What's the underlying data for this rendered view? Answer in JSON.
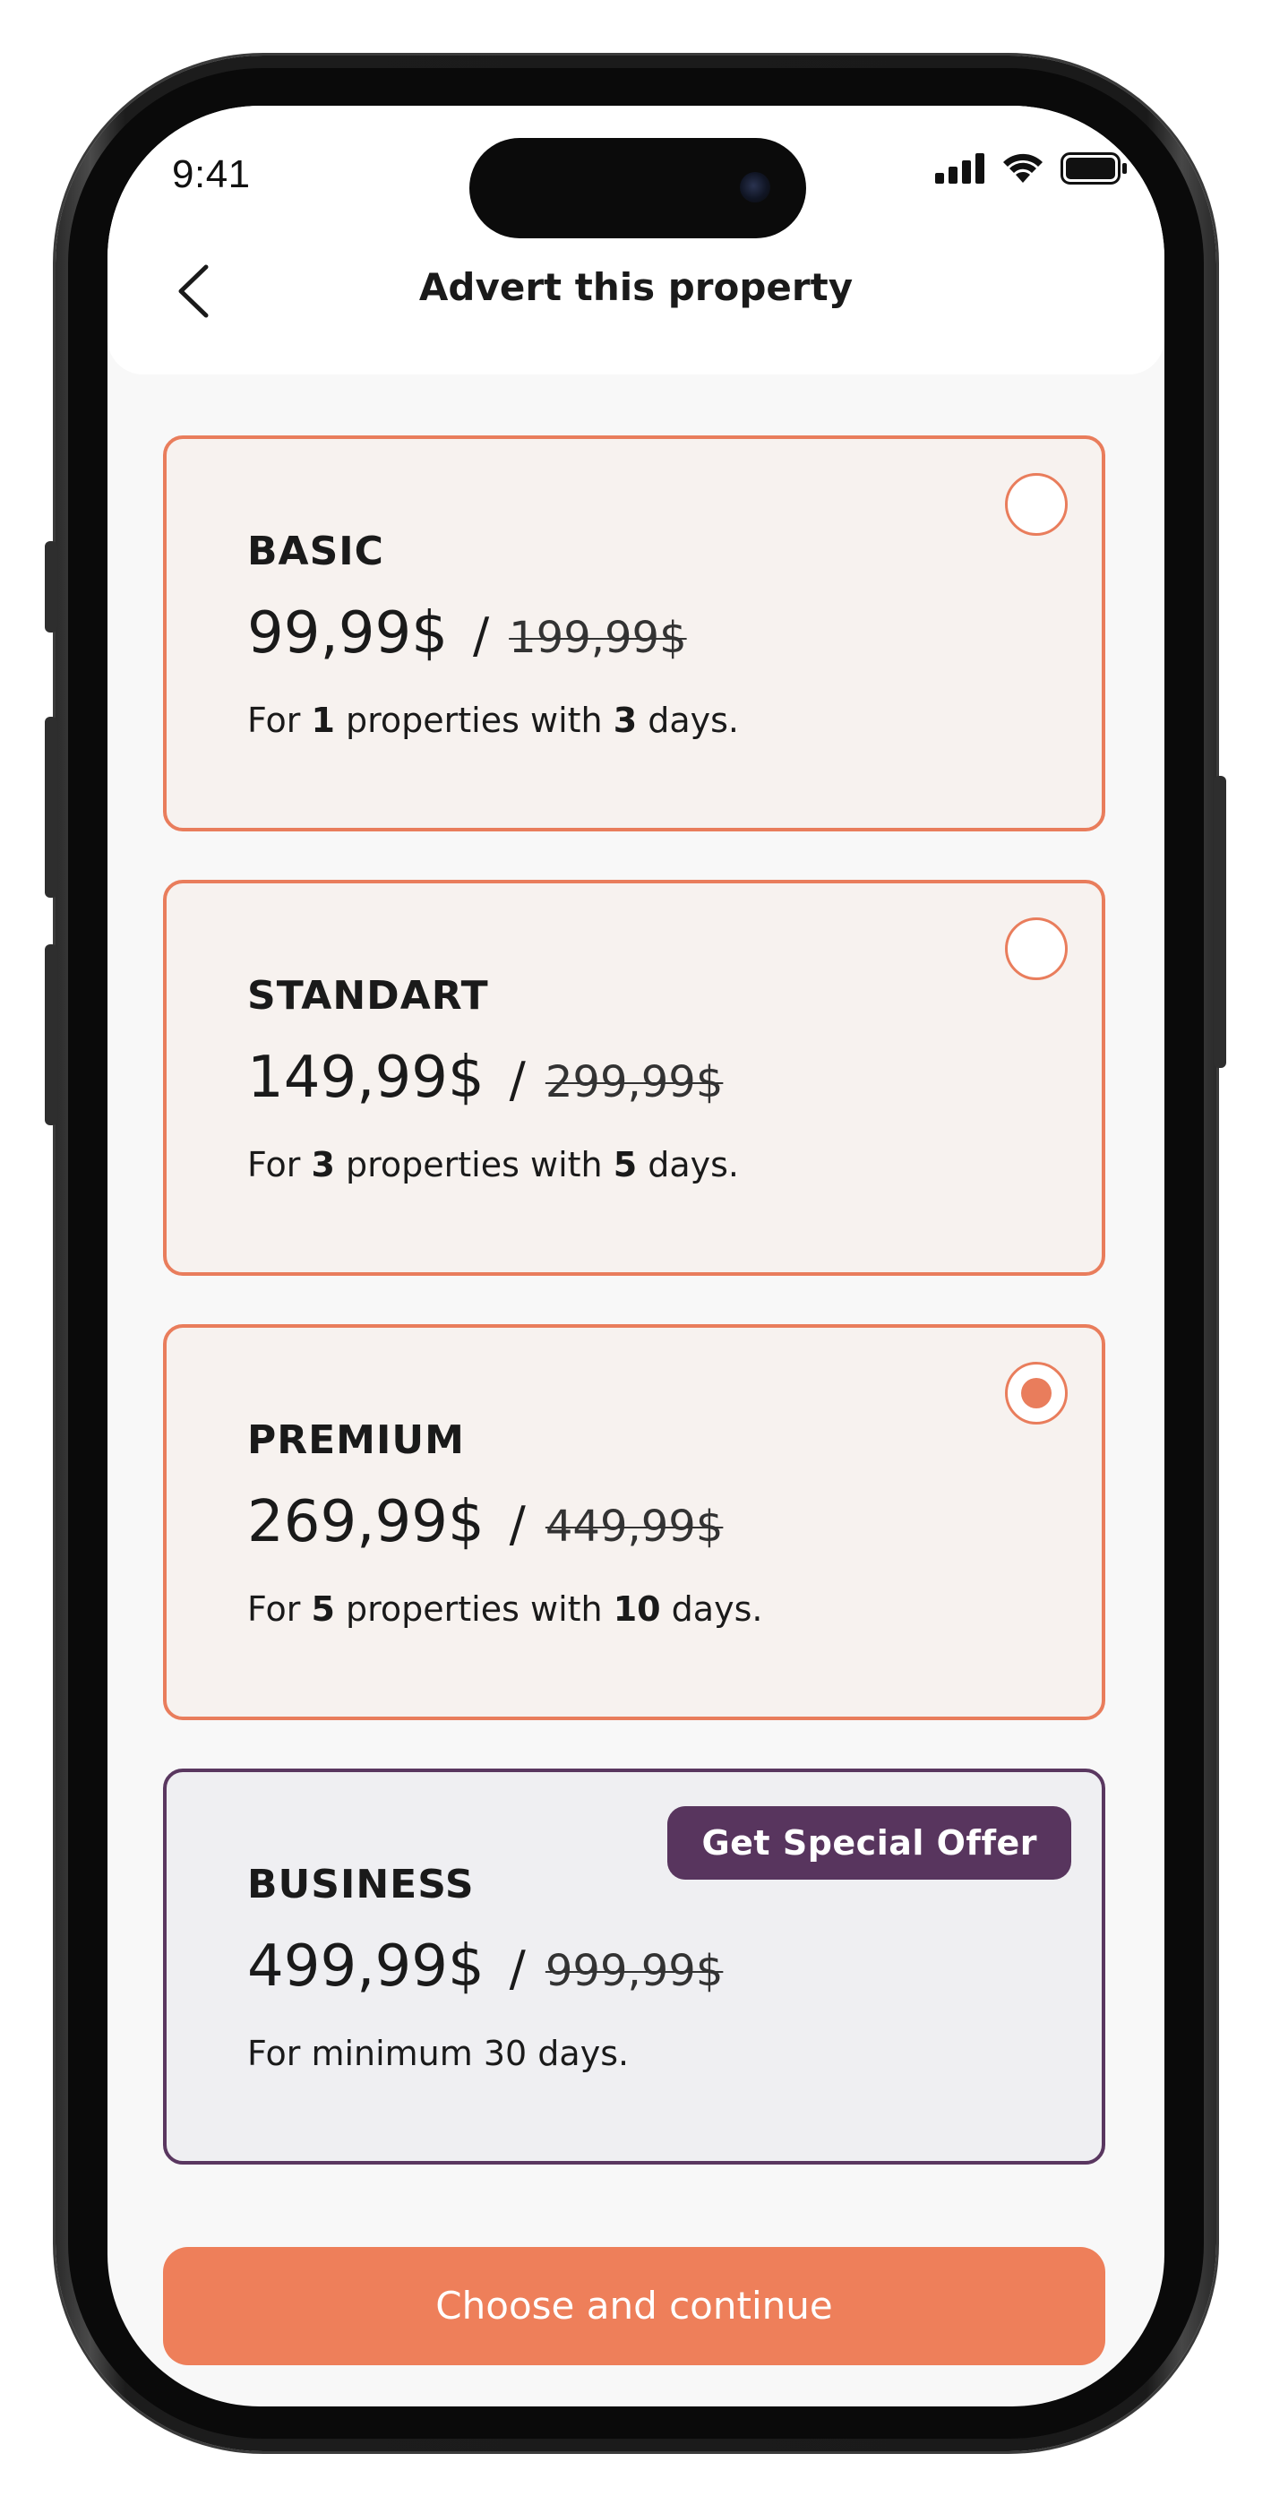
{
  "status_bar": {
    "time": "9:41",
    "icons": [
      "signal-icon",
      "wifi-icon",
      "battery-icon"
    ]
  },
  "header": {
    "title": "Advert this property",
    "back_icon": "chevron-left-icon"
  },
  "plans": [
    {
      "name": "BASIC",
      "price": "99,99$",
      "separator": "/",
      "old_price": "199,99$",
      "desc_prefix": "For ",
      "properties": "1",
      "desc_middle": " properties with ",
      "days": "3",
      "desc_suffix": " days.",
      "selected": false
    },
    {
      "name": "STANDART",
      "price": "149,99$",
      "separator": "/",
      "old_price": "299,99$",
      "desc_prefix": "For ",
      "properties": "3",
      "desc_middle": " properties with ",
      "days": "5",
      "desc_suffix": " days.",
      "selected": false
    },
    {
      "name": "PREMIUM",
      "price": "269,99$",
      "separator": "/",
      "old_price": "449,99$",
      "desc_prefix": "For ",
      "properties": "5",
      "desc_middle": " properties with ",
      "days": "10",
      "desc_suffix": " days.",
      "selected": true
    },
    {
      "name": "BUSINESS",
      "price": "499,99$",
      "separator": "/",
      "old_price": "999,99$",
      "description": "For minimum 30 days.",
      "badge": "Get Special Offer"
    }
  ],
  "cta": {
    "label": "Choose and continue"
  },
  "colors": {
    "accent": "#ee7f5a",
    "card_background": "#f7f2ef",
    "business_accent": "#58355e",
    "business_background": "#efeff2",
    "screen_background": "#f8f8f8"
  }
}
